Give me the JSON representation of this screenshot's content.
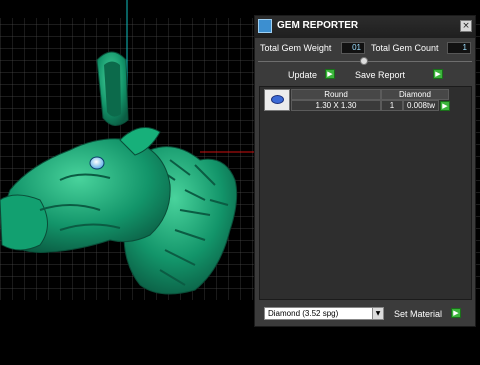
{
  "panel": {
    "title": "GEM REPORTER",
    "close_icon": "×",
    "total_gem_weight_label": "Total Gem Weight",
    "total_gem_weight_value": "01",
    "total_gem_count_label": "Total Gem Count",
    "total_gem_count_value": "1",
    "update_label": "Update",
    "save_report_label": "Save Report",
    "button_glyph": "▶",
    "table": {
      "headers": [
        "Round",
        "Diamond"
      ],
      "rows": [
        {
          "size": "1.30 X 1.30",
          "count": "1",
          "weight": "0.008tw"
        }
      ]
    },
    "material_select": "Diamond    (3.52 spg)",
    "material_dropdown_glyph": "▼",
    "set_material_label": "Set Material"
  },
  "colors": {
    "model": "#14a36c",
    "grid_line": "#555555",
    "crosshair_v": "#0fbfbf",
    "crosshair_h": "#cc1111",
    "button_green": "#3bb43b"
  },
  "icons": {
    "app": "gem-reporter-app-icon",
    "close": "close-icon",
    "update": "play-icon",
    "save": "play-icon",
    "row": "play-icon",
    "material": "play-icon",
    "dropdown": "chevron-down-icon"
  }
}
